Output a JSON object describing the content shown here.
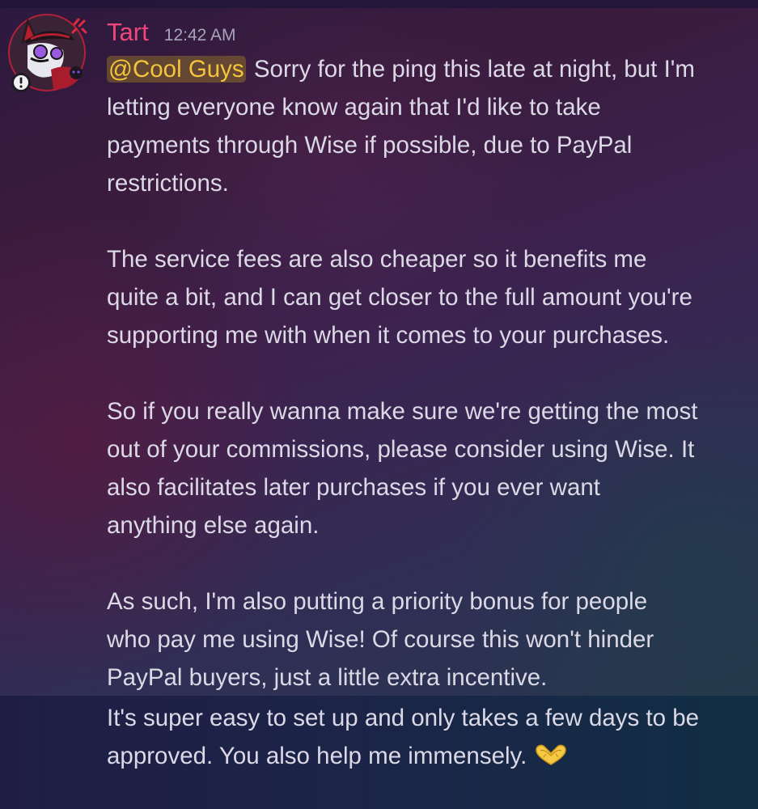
{
  "message": {
    "author": "Tart",
    "time": "12:42 AM",
    "mention": "@Cool Guys",
    "paragraphs": [
      [
        "Sorry for the ping this late at night, but I'm",
        "letting everyone know again that I'd like to take",
        "payments through Wise if possible, due to PayPal",
        "restrictions."
      ],
      [
        "The service fees are also cheaper so it benefits me",
        "quite a bit, and I can get closer to the full amount you're",
        "supporting me with when it comes to your purchases."
      ],
      [
        "So if you really wanna make sure we're getting the most",
        "out of your commissions, please consider using Wise. It",
        "also facilitates later purchases if you ever want",
        "anything else again."
      ],
      [
        "As such, I'm also putting a priority bonus for people",
        "who pay me using Wise! Of course this won't hinder",
        "PayPal buyers, just a little extra incentive."
      ]
    ]
  },
  "followup": {
    "lines": [
      "It's super easy to set up and only takes a few days to be",
      "approved. You also help me immensely."
    ],
    "emoji_icon": "heart-hands-emoji"
  },
  "colors": {
    "username": "#f0467c",
    "mention_text": "#f3c43c",
    "body_text": "#dcd9e6",
    "timestamp": "#a7a3ba"
  }
}
